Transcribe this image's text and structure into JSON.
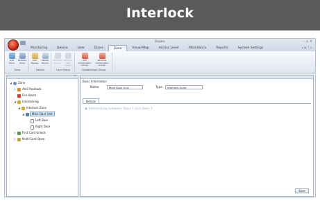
{
  "banner": {
    "title": "Interlock"
  },
  "app": {
    "title": "Enpass",
    "window_controls": "– ▫ ×",
    "ribbon_controls": "⌂ ◐ ? ×"
  },
  "tabs": [
    {
      "label": "Monitoring",
      "active": false
    },
    {
      "label": "Device",
      "active": false
    },
    {
      "label": "User",
      "active": false
    },
    {
      "label": "Doors",
      "active": false
    },
    {
      "label": "Zone",
      "active": true
    },
    {
      "label": "Visual Map",
      "active": false
    },
    {
      "label": "Access Level",
      "active": false
    },
    {
      "label": "Attendance",
      "active": false
    },
    {
      "label": "Reports",
      "active": false
    },
    {
      "label": "System Settings",
      "active": false
    }
  ],
  "ribbon": {
    "buttons": [
      {
        "label": "Add Zone",
        "icon": "add-zone-icon",
        "enabled": true
      },
      {
        "label": "Remove Zone",
        "icon": "remove-zone-icon",
        "enabled": true
      },
      {
        "label": "Add Device",
        "icon": "add-device-icon",
        "enabled": true
      },
      {
        "label": "Delete Device",
        "icon": "delete-device-icon",
        "enabled": true
      },
      {
        "label": "Add User Group",
        "icon": "add-user-group-icon",
        "enabled": false
      },
      {
        "label": "Remove User Group",
        "icon": "remove-user-group-icon",
        "enabled": false
      },
      {
        "label": "Add Combination Group",
        "icon": "add-combination-group-icon",
        "enabled": true
      },
      {
        "label": "Remove Combination Group",
        "icon": "remove-combination-group-icon",
        "enabled": true
      }
    ],
    "groups": [
      "Zone",
      "Device",
      "User Group",
      "Combination Group"
    ]
  },
  "tree": {
    "nodes": [
      {
        "label": "Zone",
        "icon": "globe-icon",
        "expander": "◢"
      },
      {
        "label": "Anti Passback",
        "icon": "anti-passback-icon",
        "expander": "▷"
      },
      {
        "label": "Fire Alarm",
        "icon": "fire-alarm-icon",
        "expander": ""
      },
      {
        "label": "Interlocking",
        "icon": "interlocking-icon",
        "expander": "◢"
      },
      {
        "label": "Interlock Zone",
        "icon": "interlock-zone-icon",
        "expander": "◢"
      },
      {
        "label": "Main Door Unit",
        "icon": "door-unit-icon",
        "expander": "◢"
      },
      {
        "label": "Left Door",
        "icon": "door-icon",
        "expander": ""
      },
      {
        "label": "Right Door",
        "icon": "door-icon",
        "expander": ""
      },
      {
        "label": "First Card Unlock",
        "icon": "card-icon",
        "expander": "▷"
      },
      {
        "label": "Multi-Card Open",
        "icon": "cards-icon",
        "expander": "▷"
      }
    ]
  },
  "basic": {
    "section": "Basic Information",
    "name_label": "Name",
    "name_value": "Main Door Unit",
    "type_label": "Type",
    "type_value": "Interlock Zone"
  },
  "details": {
    "tab_label": "Details",
    "text": "Interlocking between Door 1 and Door 2"
  },
  "save_label": "Save",
  "colors": {
    "banner": "#5a5a5c",
    "accent": "#cfe3fb",
    "hint_text": "#9fb2c8"
  }
}
